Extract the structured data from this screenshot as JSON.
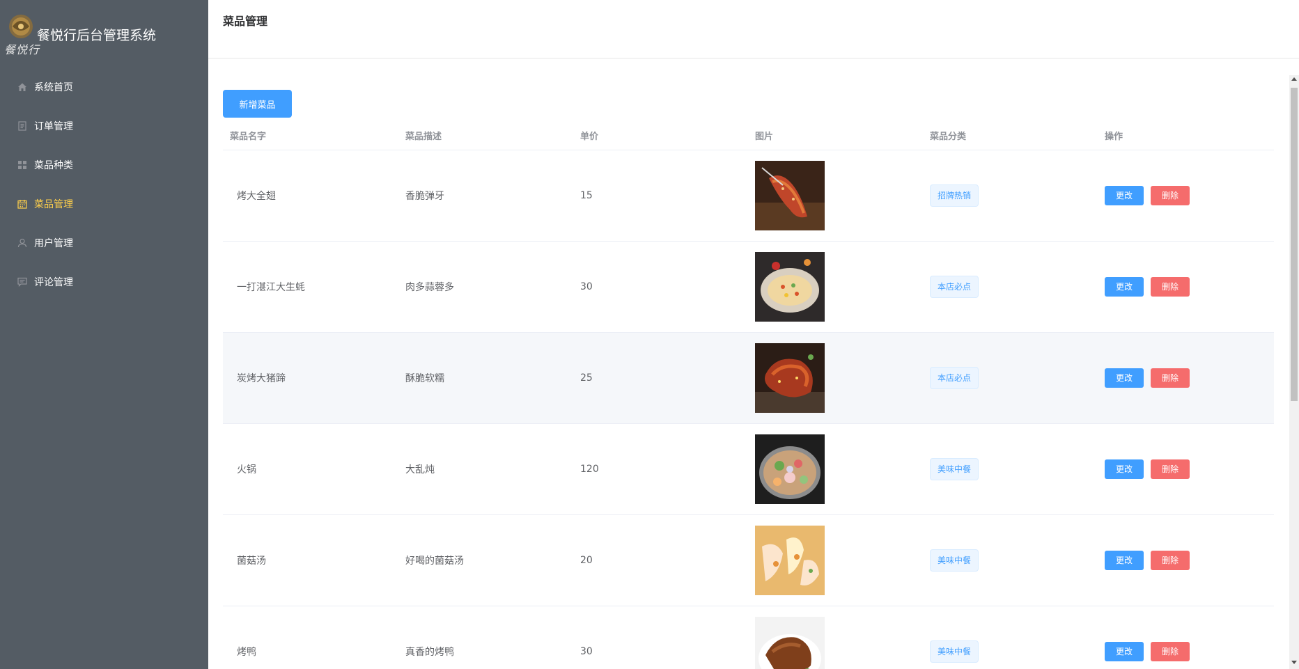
{
  "app": {
    "title": "餐悦行后台管理系统",
    "logo_script": "餐悦行"
  },
  "sidebar": {
    "items": [
      {
        "label": "系统首页",
        "icon": "home-icon",
        "active": false
      },
      {
        "label": "订单管理",
        "icon": "document-icon",
        "active": false
      },
      {
        "label": "菜品种类",
        "icon": "grid-icon",
        "active": false
      },
      {
        "label": "菜品管理",
        "icon": "calendar-icon",
        "active": true
      },
      {
        "label": "用户管理",
        "icon": "user-icon",
        "active": false
      },
      {
        "label": "评论管理",
        "icon": "comment-icon",
        "active": false
      }
    ]
  },
  "header": {
    "title": "菜品管理"
  },
  "toolbar": {
    "add_label": "新增菜品"
  },
  "table": {
    "columns": [
      "菜品名字",
      "菜品描述",
      "单价",
      "图片",
      "菜品分类",
      "操作"
    ],
    "rows": [
      {
        "name": "烤大全翅",
        "desc": "香脆弹牙",
        "price": "15",
        "category": "招牌热销",
        "image": "grilled-wings"
      },
      {
        "name": "一打湛江大生蚝",
        "desc": "肉多蒜蓉多",
        "price": "30",
        "category": "本店必点",
        "image": "grilled-oyster"
      },
      {
        "name": "炭烤大猪蹄",
        "desc": "酥脆软糯",
        "price": "25",
        "category": "本店必点",
        "image": "pork-trotter"
      },
      {
        "name": "火锅",
        "desc": "大乱炖",
        "price": "120",
        "category": "美味中餐",
        "image": "hotpot"
      },
      {
        "name": "菌菇汤",
        "desc": "好喝的菌菇汤",
        "price": "20",
        "category": "美味中餐",
        "image": "mushroom-soup"
      },
      {
        "name": "烤鸭",
        "desc": "真香的烤鸭",
        "price": "30",
        "category": "美味中餐",
        "image": "roast-duck"
      }
    ],
    "edit_label": "更改",
    "delete_label": "删除"
  },
  "colors": {
    "sidebar_bg": "#545c64",
    "active_menu": "#ffd04b",
    "primary": "#409eff",
    "danger": "#f56c6c"
  }
}
